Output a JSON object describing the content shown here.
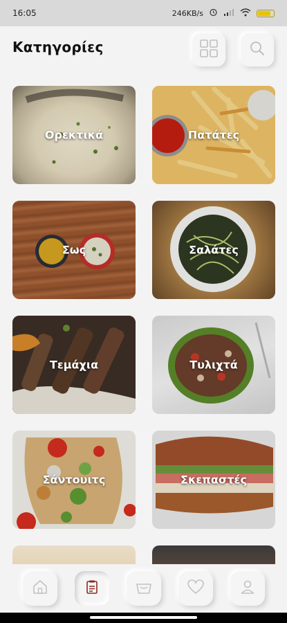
{
  "status_bar": {
    "time": "16:05",
    "speed": "246KB/s",
    "battery_level": 0.85
  },
  "header": {
    "title": "Κατηγορίες"
  },
  "categories": [
    {
      "label": "Ορεκτικά"
    },
    {
      "label": "Πατάτες"
    },
    {
      "label": "Σως"
    },
    {
      "label": "Σαλάτες"
    },
    {
      "label": "Τεμάχια"
    },
    {
      "label": "Τυλιχτά"
    },
    {
      "label": "Σάντουιτς"
    },
    {
      "label": "Σκεπαστές"
    }
  ],
  "bottom_nav": [
    {
      "icon": "home-icon",
      "active": false
    },
    {
      "icon": "menu-list-icon",
      "active": true
    },
    {
      "icon": "basket-icon",
      "active": false
    },
    {
      "icon": "heart-icon",
      "active": false
    },
    {
      "icon": "profile-icon",
      "active": false
    }
  ],
  "colors": {
    "background": "#f3f3f3",
    "accent": "#8b2a1e"
  }
}
